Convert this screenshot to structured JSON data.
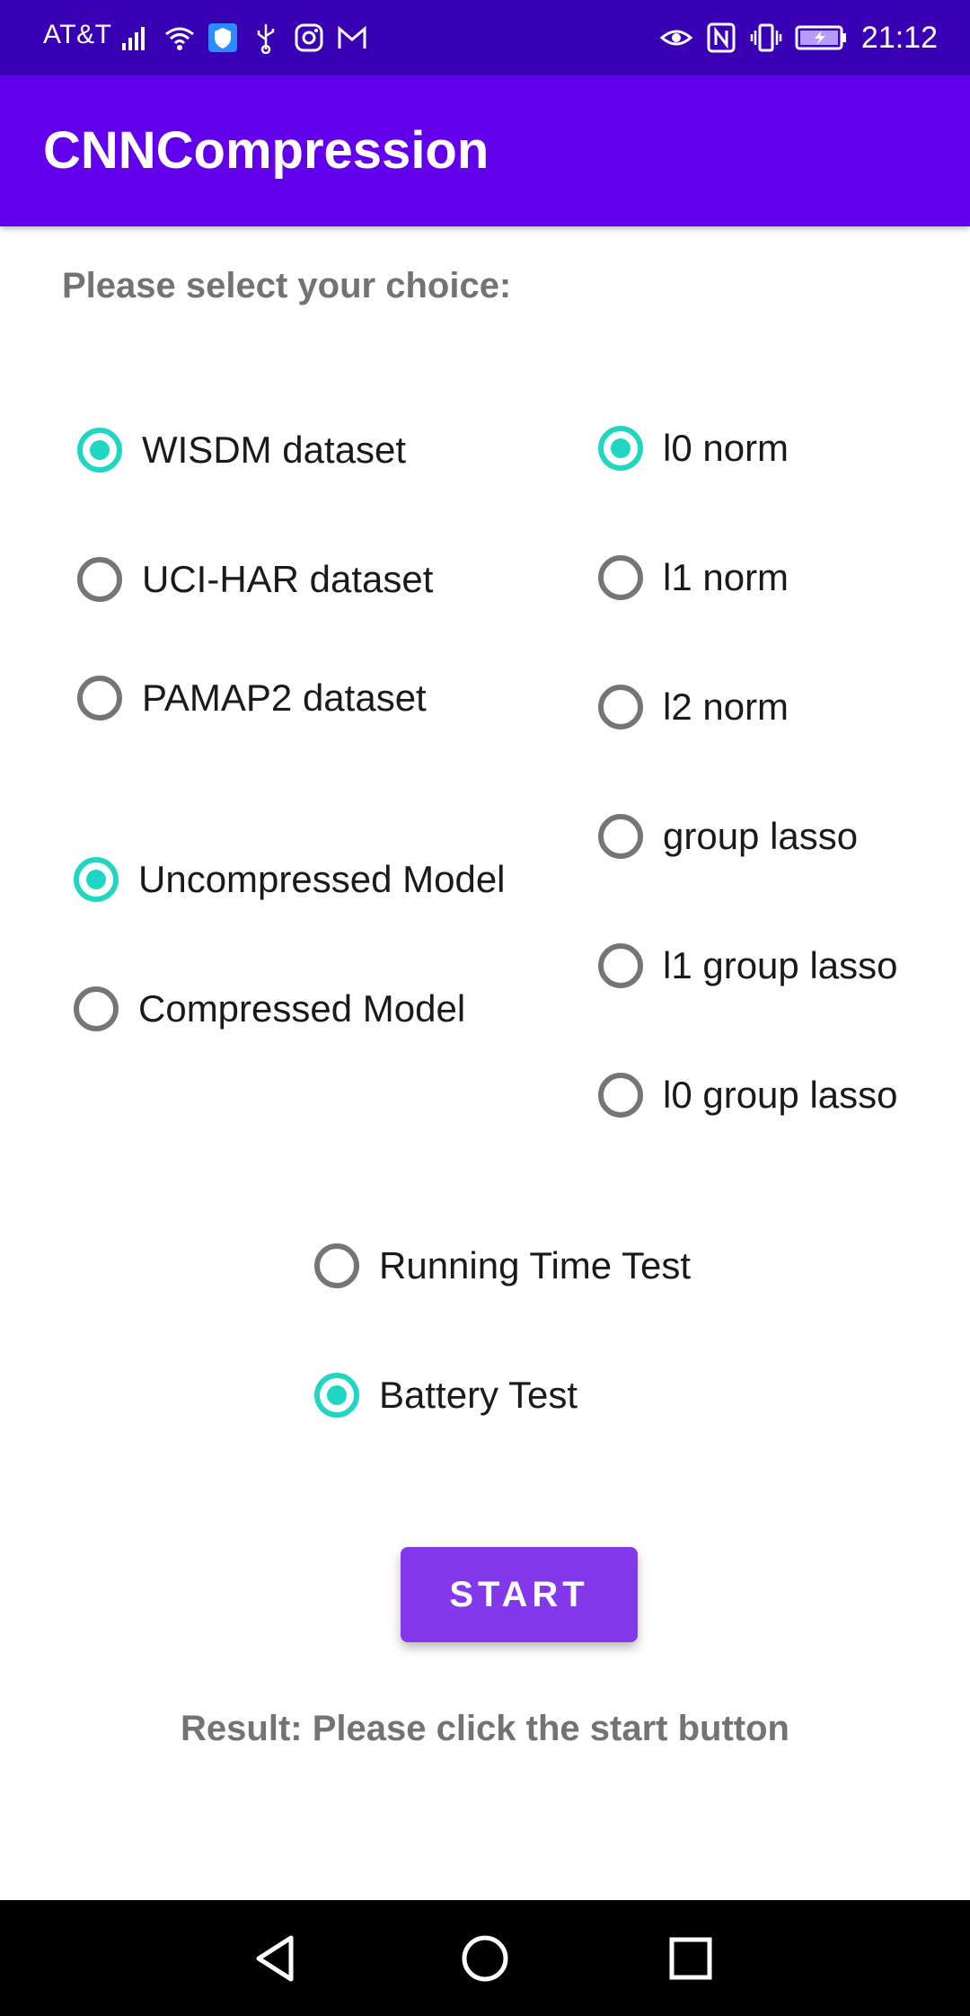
{
  "status_bar": {
    "carrier": "AT&T",
    "time": "21:12",
    "left_icons": [
      "signal-icon",
      "wifi-icon",
      "shield-icon",
      "usb-icon",
      "instagram-icon",
      "gmail-icon"
    ],
    "right_icons": [
      "eye-icon",
      "nfc-icon",
      "vibrate-icon",
      "battery-charging-icon"
    ],
    "background_color": "#3a00b4"
  },
  "app_bar": {
    "title": "CNNCompression",
    "background_color": "#6200ee"
  },
  "main": {
    "prompt": "Please select your choice:",
    "dataset_group": [
      {
        "label": "WISDM dataset",
        "checked": true
      },
      {
        "label": "UCI-HAR dataset",
        "checked": false
      },
      {
        "label": "PAMAP2 dataset",
        "checked": false
      }
    ],
    "model_group": [
      {
        "label": "Uncompressed Model",
        "checked": true
      },
      {
        "label": "Compressed Model",
        "checked": false
      }
    ],
    "norm_group": [
      {
        "label": "l0 norm",
        "checked": true
      },
      {
        "label": "l1 norm",
        "checked": false
      },
      {
        "label": "l2 norm",
        "checked": false
      },
      {
        "label": "group lasso",
        "checked": false
      },
      {
        "label": "l1 group lasso",
        "checked": false
      },
      {
        "label": "l0 group lasso",
        "checked": false
      }
    ],
    "test_group": [
      {
        "label": "Running Time Test",
        "checked": false
      },
      {
        "label": "Battery Test",
        "checked": true
      }
    ],
    "start_button": "START",
    "result_text": "Result: Please click the start button"
  },
  "nav_bar": {
    "buttons": [
      "back-icon",
      "home-icon",
      "recents-icon"
    ]
  },
  "colors": {
    "accent": "#1fd6c2",
    "button": "#8338ec",
    "secondary_text": "#737373"
  }
}
